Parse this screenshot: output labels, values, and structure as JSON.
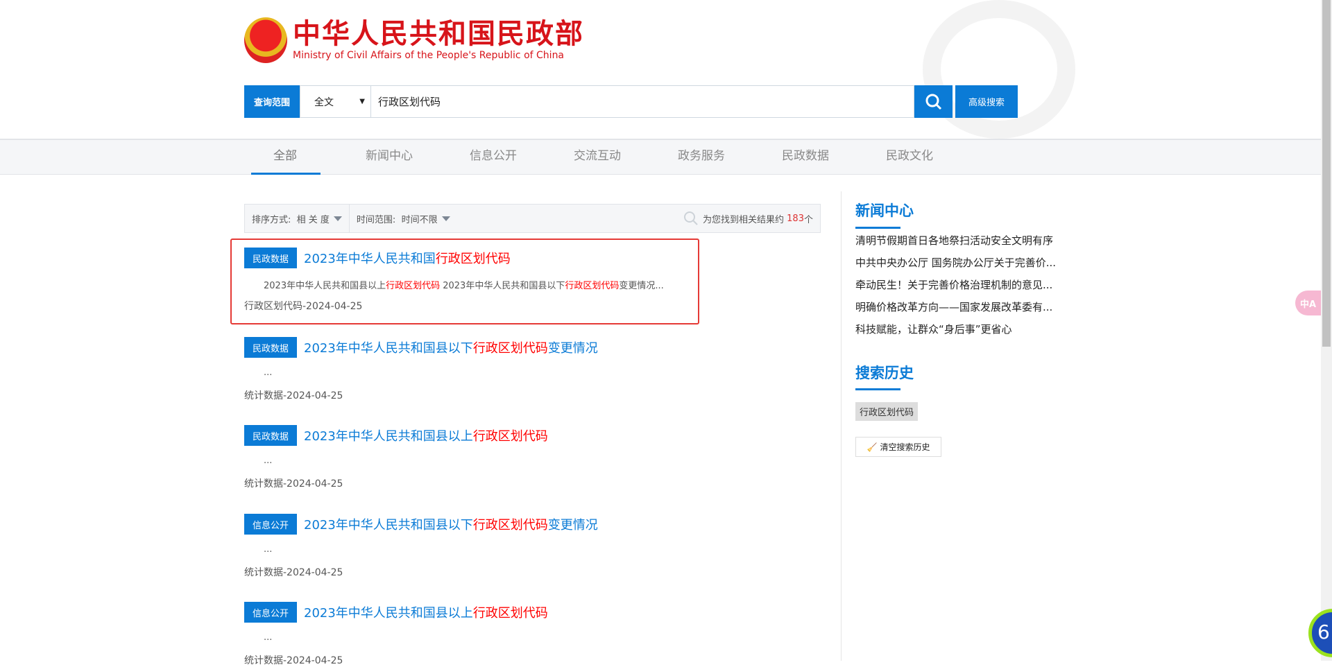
{
  "logo": {
    "cn": "中华人民共和国民政部",
    "en": "Ministry of Civil Affairs of the People's Republic of China"
  },
  "search": {
    "scope_label": "查询范围",
    "scope_value": "全文",
    "query": "行政区划代码",
    "advanced_label": "高级搜索"
  },
  "nav": {
    "items": [
      {
        "label": "全部"
      },
      {
        "label": "新闻中心"
      },
      {
        "label": "信息公开"
      },
      {
        "label": "交流互动"
      },
      {
        "label": "政务服务"
      },
      {
        "label": "民政数据"
      },
      {
        "label": "民政文化"
      }
    ],
    "active": "全部"
  },
  "filter": {
    "sort_label": "排序方式:",
    "sort_value": "相 关 度",
    "time_label": "时间范围:",
    "time_value": "时间不限",
    "count_prefix": "为您找到相关结果约",
    "count": "183",
    "count_suffix": "个"
  },
  "results": [
    {
      "tag": "民政数据",
      "title_pre": "2023年中华人民共和国",
      "title_hl": "行政区划代码",
      "title_post": "",
      "summary": [
        "2023年中华人民共和国县以上",
        "行政区划代码",
        " 2023年中华人民共和国县以下",
        "行政区划代码",
        "变更情况..."
      ],
      "meta": "行政区划代码-2024-04-25"
    },
    {
      "tag": "民政数据",
      "title_pre": "2023年中华人民共和国县以下",
      "title_hl": "行政区划代码",
      "title_post": "变更情况",
      "summary_plain": "...",
      "meta": "统计数据-2024-04-25"
    },
    {
      "tag": "民政数据",
      "title_pre": "2023年中华人民共和国县以上",
      "title_hl": "行政区划代码",
      "title_post": "",
      "summary_plain": "...",
      "meta": "统计数据-2024-04-25"
    },
    {
      "tag": "信息公开",
      "title_pre": "2023年中华人民共和国县以下",
      "title_hl": "行政区划代码",
      "title_post": "变更情况",
      "summary_plain": "...",
      "meta": "统计数据-2024-04-25"
    },
    {
      "tag": "信息公开",
      "title_pre": "2023年中华人民共和国县以上",
      "title_hl": "行政区划代码",
      "title_post": "",
      "summary_plain": "...",
      "meta": "统计数据-2024-04-25"
    }
  ],
  "sidebar": {
    "news_title": "新闻中心",
    "news": [
      "清明节假期首日各地祭扫活动安全文明有序",
      "中共中央办公厅  国务院办公厅关于完善价...",
      "牵动民生！关于完善价格治理机制的意见...",
      "明确价格改革方向——国家发展改革委有...",
      "科技赋能，让群众“身后事”更省心"
    ],
    "history_title": "搜索历史",
    "history": [
      "行政区划代码"
    ],
    "clear_label": "清空搜索历史"
  },
  "widgets": {
    "translate": "中A",
    "badge": "6"
  },
  "colors": {
    "accent": "#0b7bd6",
    "highlight": "#ff0000",
    "brand_red": "#d7141a"
  }
}
